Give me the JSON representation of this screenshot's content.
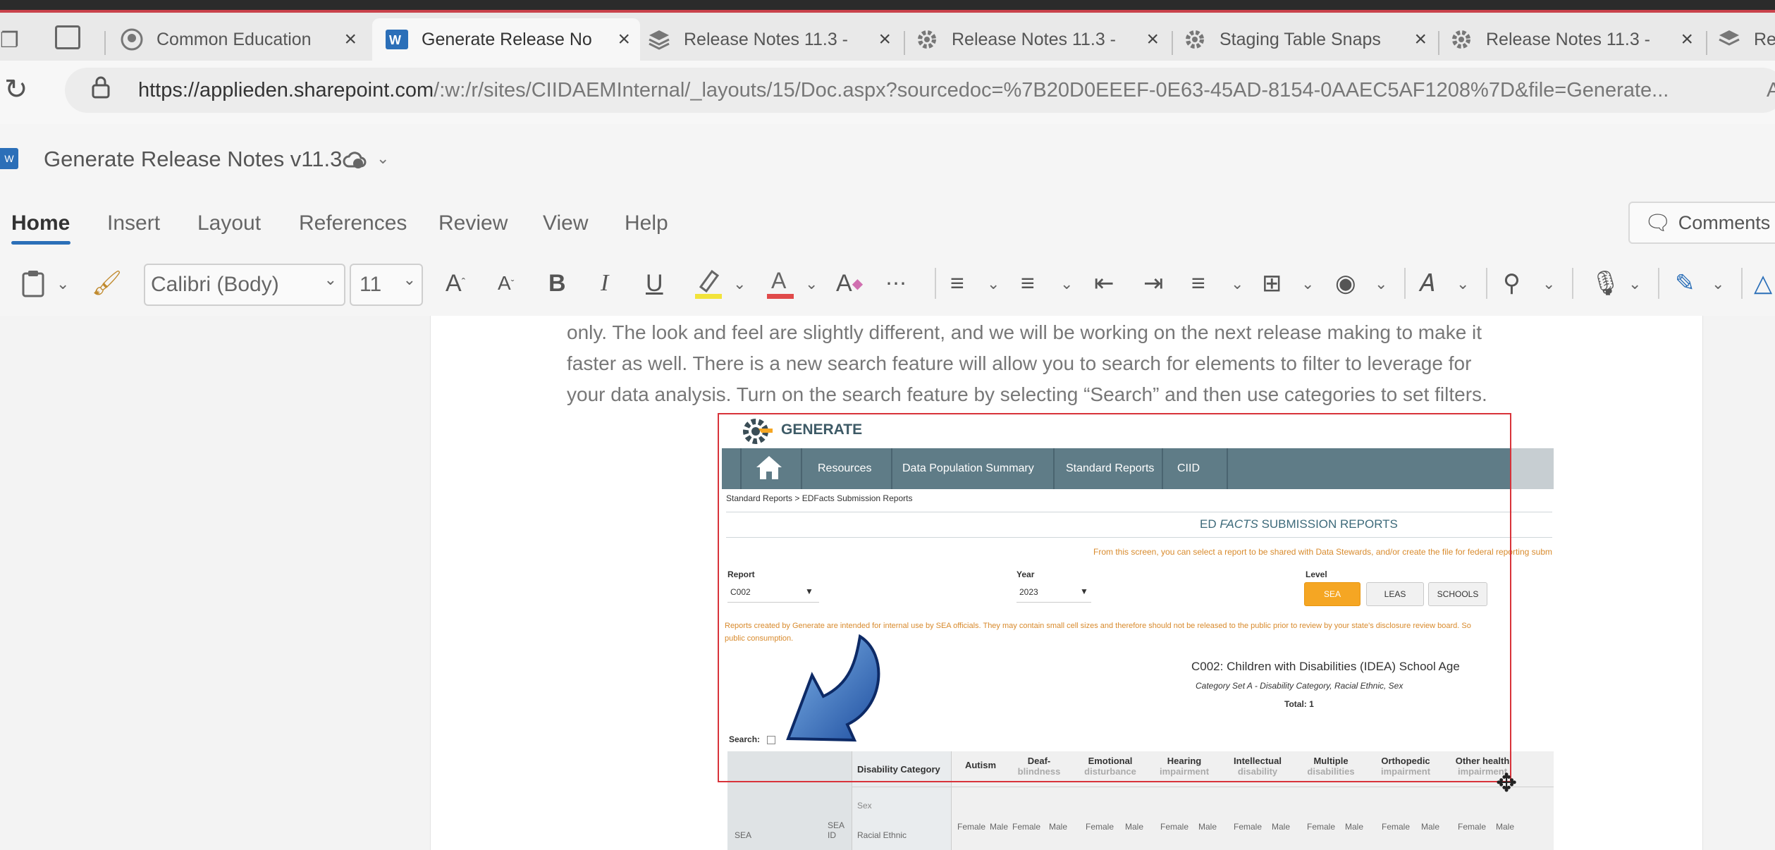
{
  "browser": {
    "tabs": [
      {
        "label": "Common Education",
        "icon": "github-icon"
      },
      {
        "label": "Generate Release No",
        "icon": "word-icon",
        "active": true
      },
      {
        "label": "Release Notes 11.3 -",
        "icon": "stack-icon"
      },
      {
        "label": "Release Notes 11.3 -",
        "icon": "gear-logo-icon"
      },
      {
        "label": "Staging Table Snaps",
        "icon": "gear-logo-icon"
      },
      {
        "label": "Release Notes 11.3 -",
        "icon": "gear-logo-icon"
      },
      {
        "label": "Re",
        "icon": "stack-icon"
      }
    ],
    "url_host": "https://applieden.sharepoint.com",
    "url_rest": "/:w:/r/sites/CIIDAEMInternal/_layouts/15/Doc.aspx?sourcedoc=%7B20D0EEEF-0E63-45AD-8154-0AAEC5AF1208%7D&file=Generate...",
    "url_tail": "A"
  },
  "word": {
    "doc_title": "Generate Release Notes v11.3",
    "ribbon_tabs": [
      "Home",
      "Insert",
      "Layout",
      "References",
      "Review",
      "View",
      "Help"
    ],
    "comments_label": "Comments",
    "font_name": "Calibri (Body)",
    "font_size": "11"
  },
  "document": {
    "lines": [
      "only.  The look and feel are slightly different, and we will be working on the next release making to make it",
      "faster as well. There is a new search feature will allow you to search for elements to filter to leverage for",
      "your data analysis. Turn on the search feature by selecting “Search” and then use categories to set filters."
    ]
  },
  "embedded": {
    "logo_text": "GENERATE",
    "nav": [
      "Resources",
      "Data Population Summary",
      "Standard Reports",
      "CIID"
    ],
    "breadcrumb": "Standard Reports > EDFacts Submission Reports",
    "heading_prefix": "ED",
    "heading_italic": "FACTS",
    "heading_suffix": "SUBMISSION REPORTS",
    "intro": "From this screen, you can select a report to be shared with Data Stewards, and/or create the file for federal reporting subm",
    "report_label": "Report",
    "report_value": "C002",
    "year_label": "Year",
    "year_value": "2023",
    "level_label": "Level",
    "levels": [
      "SEA",
      "LEAS",
      "SCHOOLS"
    ],
    "disclaimer_1": "Reports created by Generate are intended for internal use by SEA officials. They may contain small cell sizes and therefore should not be released to the public prior to review by your state's disclosure review board. So",
    "disclaimer_2": "public consumption.",
    "report_title": "C002: Children with Disabilities (IDEA) School Age",
    "report_subtitle": "Category Set A - Disability Category, Racial Ethnic, Sex",
    "report_total": "Total: 1",
    "search_label": "Search:",
    "table_header": "Disability Category",
    "columns": [
      "Autism",
      "Deaf-blindness",
      "Emotional disturbance",
      "Hearing impairment",
      "Intellectual disability",
      "Multiple disabilities",
      "Orthopedic impairment",
      "Other health impairment"
    ],
    "col_top": [
      "Autism",
      "Deaf-",
      "Emotional",
      "Hearing",
      "Intellectual",
      "Multiple",
      "Orthopedic",
      "Other health"
    ],
    "col_bottom": [
      "",
      "blindness",
      "disturbance",
      "impairment",
      "disability",
      "disabilities",
      "impairment",
      "impairment"
    ],
    "row_labels": [
      "Sex",
      "Racial Ethnic"
    ],
    "sea_label": "SEA",
    "sea_id_label": "SEA ID",
    "sex_values": [
      "Female",
      "Male"
    ],
    "brand_color": "#5f7c87",
    "accent_color": "#f5a623"
  }
}
